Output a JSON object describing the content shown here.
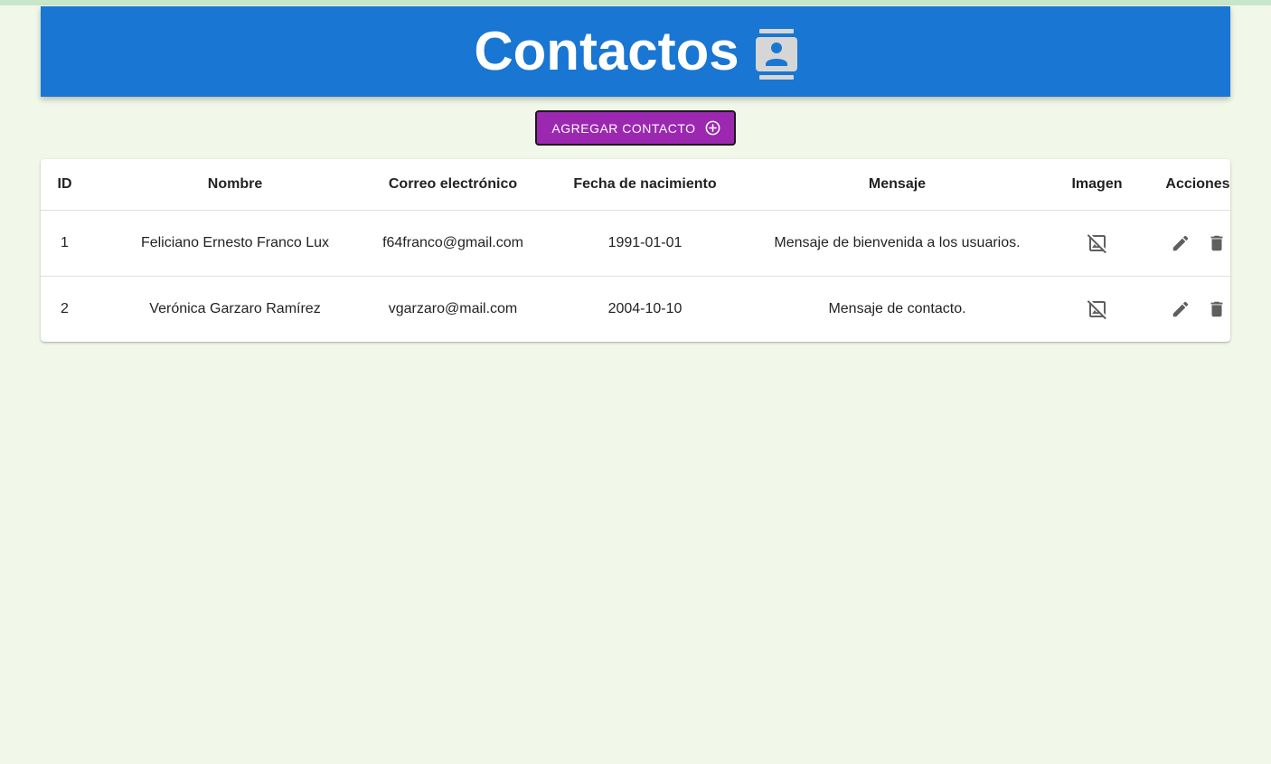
{
  "header": {
    "title": "Contactos",
    "icon": "contact-card-icon",
    "background": "#1976d2"
  },
  "toolbar": {
    "add_label": "AGREGAR CONTACTO",
    "add_icon": "add-circle-icon",
    "add_color": "#9c27b0"
  },
  "table": {
    "columns": [
      "ID",
      "Nombre",
      "Correo electrónico",
      "Fecha de nacimiento",
      "Mensaje",
      "Imagen",
      "Acciones"
    ],
    "rows": [
      {
        "id": "1",
        "nombre": "Feliciano Ernesto Franco Lux",
        "correo": "f64franco@gmail.com",
        "fecha": "1991-01-01",
        "mensaje": "Mensaje de bienvenida a los usuarios.",
        "imagen_icon": "image-not-supported-icon"
      },
      {
        "id": "2",
        "nombre": "Verónica Garzaro Ramírez",
        "correo": "vgarzaro@mail.com",
        "fecha": "2004-10-10",
        "mensaje": "Mensaje de contacto.",
        "imagen_icon": "image-not-supported-icon"
      }
    ],
    "action_icons": [
      "edit-icon",
      "delete-icon"
    ]
  }
}
